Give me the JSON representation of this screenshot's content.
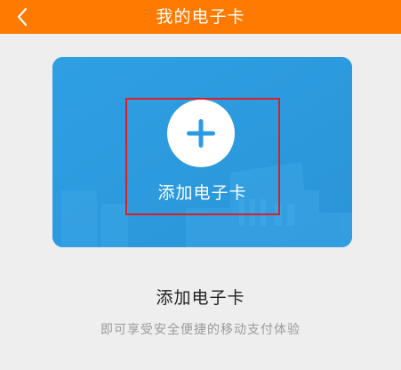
{
  "header": {
    "title": "我的电子卡",
    "back_icon": "chevron-left-icon",
    "background_color": "#ff7a00"
  },
  "card": {
    "label": "添加电子卡",
    "plus_icon": "plus-icon",
    "background_color": "#2c9be1",
    "highlight_color": "#d92027"
  },
  "info": {
    "heading": "添加电子卡",
    "subtext": "即可享受安全便捷的移动支付体验"
  }
}
